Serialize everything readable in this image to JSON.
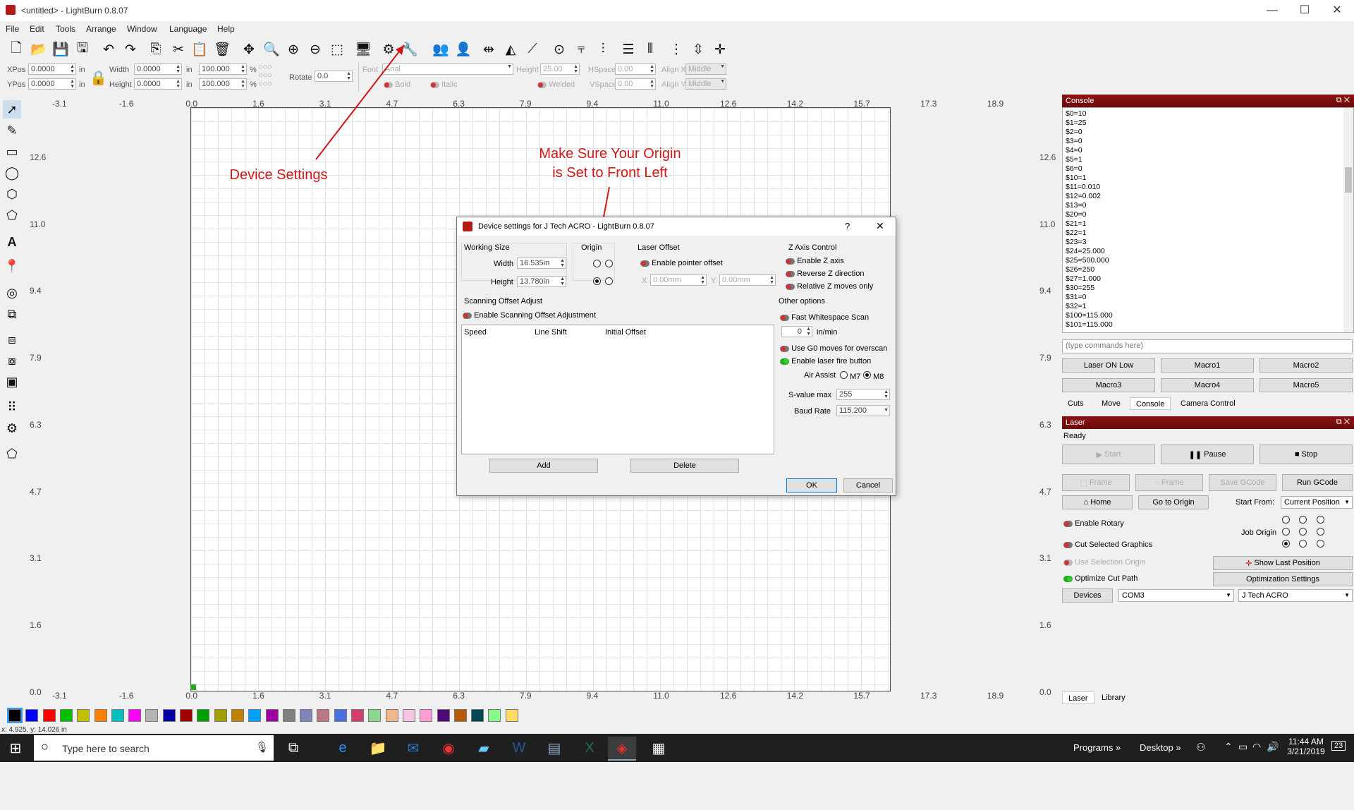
{
  "window": {
    "title": "<untitled> - LightBurn 0.8.07",
    "minimize": "—",
    "maximize": "☐",
    "close": "✕"
  },
  "menu": [
    "File",
    "Edit",
    "Tools",
    "Arrange",
    "Window",
    "Language",
    "Help"
  ],
  "numeric_bar": {
    "xpos_label": "XPos",
    "xpos_value": "0.0000",
    "ypos_label": "YPos",
    "ypos_value": "0.0000",
    "unit": "in",
    "width_label": "Width",
    "width_value": "0.0000",
    "height_label": "Height",
    "height_value": "0.0000",
    "scale_w": "100.000",
    "scale_h": "100.000",
    "pct": "%",
    "rotate_label": "Rotate",
    "rotate_value": "0.0",
    "font_label": "Font",
    "font_value": "Arial",
    "font_height_label": "Height",
    "font_height_value": "25.00",
    "hspace_label": "HSpace",
    "hspace_value": "0.00",
    "vspace_label": "VSpace",
    "vspace_value": "0.00",
    "alignx_label": "Align X",
    "alignx_value": "Middle",
    "aligny_label": "Align Y",
    "aligny_value": "Middle",
    "bold": "Bold",
    "italic": "Italic",
    "welded": "Welded"
  },
  "rulers": {
    "x_ticks": [
      "-3.1",
      "-1.6",
      "0.0",
      "1.6",
      "3.1",
      "4.7",
      "6.3",
      "7.9",
      "9.4",
      "11.0",
      "12.6",
      "14.2",
      "15.7",
      "17.3",
      "18.9"
    ],
    "y_ticks": [
      "12.6",
      "11.0",
      "9.4",
      "7.9",
      "6.3",
      "4.7",
      "3.1",
      "1.6",
      "0.0"
    ]
  },
  "annotations": {
    "device_settings": "Device Settings",
    "origin_line1": "Make Sure Your Origin",
    "origin_line2": "is Set to Front Left"
  },
  "dialog": {
    "title": "Device settings for J Tech ACRO - LightBurn 0.8.07",
    "help": "?",
    "close": "✕",
    "working_size": "Working Size",
    "width_label": "Width",
    "width_value": "16.535in",
    "height_label": "Height",
    "height_value": "13.780in",
    "origin": "Origin",
    "laser_offset": "Laser Offset",
    "enable_pointer_offset": "Enable pointer offset",
    "x_label": "X",
    "x_value": "0.00mm",
    "y_label": "Y",
    "y_value": "0.00mm",
    "z_axis_control": "Z Axis Control",
    "enable_z": "Enable Z axis",
    "reverse_z": "Reverse Z direction",
    "relative_z": "Relative Z moves only",
    "scanning_offset": "Scanning Offset Adjust",
    "enable_scanning": "Enable Scanning Offset Adjustment",
    "col_speed": "Speed",
    "col_line_shift": "Line Shift",
    "col_initial_offset": "Initial Offset",
    "add": "Add",
    "delete": "Delete",
    "other_options": "Other options",
    "fast_whitespace": "Fast Whitespace Scan",
    "overscan_value": "0",
    "overscan_unit": "in/min",
    "use_g0": "Use G0 moves for overscan",
    "enable_fire": "Enable laser fire button",
    "air_assist": "Air Assist",
    "m7": "M7",
    "m8": "M8",
    "svalue_label": "S-value max",
    "svalue_value": "255",
    "baud_label": "Baud Rate",
    "baud_value": "115,200",
    "ok": "OK",
    "cancel": "Cancel"
  },
  "console": {
    "title": "Console",
    "lines": [
      "$0=10",
      "$1=25",
      "$2=0",
      "$3=0",
      "$4=0",
      "$5=1",
      "$6=0",
      "$10=1",
      "$11=0.010",
      "$12=0.002",
      "$13=0",
      "$20=0",
      "$21=1",
      "$22=1",
      "$23=3",
      "$24=25.000",
      "$25=500.000",
      "$26=250",
      "$27=1.000",
      "$30=255",
      "$31=0",
      "$32=1",
      "$100=115.000",
      "$101=115.000"
    ],
    "input_placeholder": "(type commands here)",
    "macros": [
      "Laser ON Low",
      "Macro1",
      "Macro2",
      "Macro3",
      "Macro4",
      "Macro5"
    ],
    "tabs": [
      "Cuts",
      "Move",
      "Console",
      "Camera Control"
    ]
  },
  "laser": {
    "title": "Laser",
    "status": "Ready",
    "start": "Start",
    "pause": "Pause",
    "stop": "Stop",
    "frame1": "Frame",
    "frame2": "Frame",
    "save_gcode": "Save GCode",
    "run_gcode": "Run GCode",
    "home": "Home",
    "go_to_origin": "Go to Origin",
    "start_from_label": "Start From:",
    "start_from_value": "Current Position",
    "enable_rotary": "Enable Rotary",
    "job_origin": "Job Origin",
    "cut_selected": "Cut Selected Graphics",
    "use_selection_origin": "Use Selection Origin",
    "show_last_position": "Show Last Position",
    "optimize_cut_path": "Optimize Cut Path",
    "optimization_settings": "Optimization Settings",
    "devices": "Devices",
    "port_value": "COM3",
    "device_value": "J Tech ACRO",
    "tabs": [
      "Laser",
      "Library"
    ]
  },
  "status_bar": {
    "coords": "x: 4.925, y: 14.026 in"
  },
  "palette_colors": [
    "#000000",
    "#0000ff",
    "#ff0000",
    "#00c000",
    "#c0c000",
    "#ff8000",
    "#00c0c0",
    "#ff00ff",
    "#b4b4b4",
    "#0000a0",
    "#a00000",
    "#00a000",
    "#a0a000",
    "#c08000",
    "#00a0ff",
    "#a000a0",
    "#808080",
    "#7d87b9",
    "#bb7784",
    "#4a6fe3",
    "#d33f6a",
    "#8cd78c",
    "#f0b98d",
    "#f6c4e1",
    "#fa9ed4",
    "#500a78",
    "#b45a00",
    "#004754",
    "#86fa88",
    "#ffdb66"
  ],
  "taskbar": {
    "search_placeholder": "Type here to search",
    "programs": "Programs",
    "desktop": "Desktop",
    "time": "11:44 AM",
    "date": "3/21/2019",
    "notifications": "23"
  }
}
